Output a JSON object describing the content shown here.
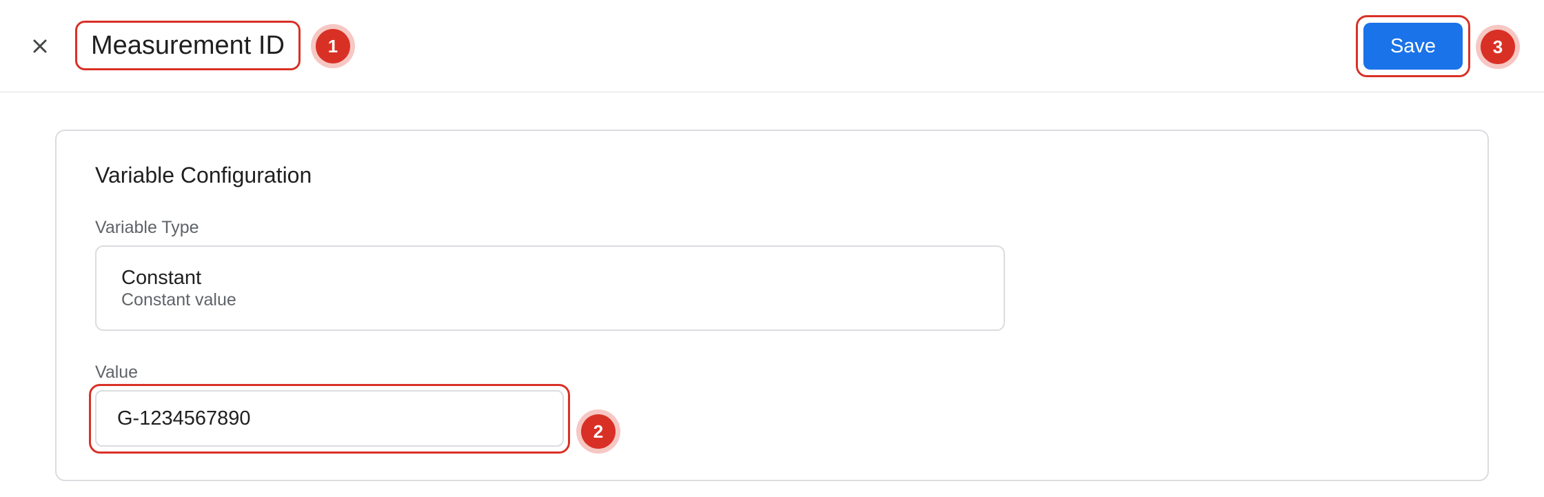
{
  "header": {
    "close_icon": "close-icon",
    "title": "Measurement ID",
    "save_label": "Save"
  },
  "annotations": {
    "marker_1": "1",
    "marker_2": "2",
    "marker_3": "3"
  },
  "card": {
    "title": "Variable Configuration",
    "variable_type_label": "Variable Type",
    "variable_type": {
      "name": "Constant",
      "description": "Constant value"
    },
    "value_label": "Value",
    "value": "G-1234567890"
  },
  "colors": {
    "accent": "#1a73e8",
    "annotation": "#d93025"
  }
}
